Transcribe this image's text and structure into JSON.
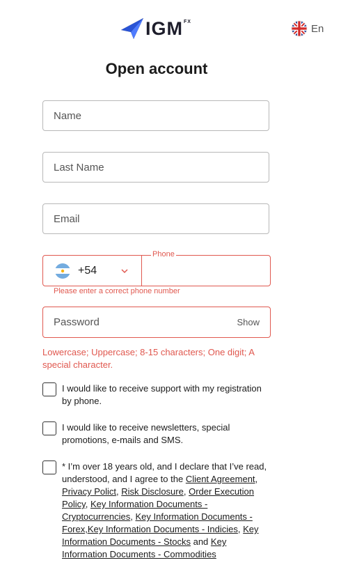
{
  "header": {
    "logo_text": "IGM",
    "logo_superscript": "FX",
    "language_label": "En",
    "language_flag": "uk-flag-icon"
  },
  "title": "Open account",
  "form": {
    "name_placeholder": "Name",
    "last_name_placeholder": "Last Name",
    "email_placeholder": "Email",
    "phone": {
      "legend": "Phone",
      "country_flag": "argentina-flag-icon",
      "dial_code": "+54",
      "error": "Please enter a correct phone number"
    },
    "password_placeholder": "Password",
    "show_label": "Show",
    "password_hint": "Lowercase; Uppercase; 8-15 characters; One digit; A special character."
  },
  "checkboxes": {
    "support_phone": "I would like to receive support with my registration by phone.",
    "newsletters": "I would like to receive newsletters, special promotions, e-mails and SMS.",
    "agreement": {
      "lead": "* I’m over 18 years old, and I declare that I’ve read, understood, and I agree to the ",
      "client_agreement": "Client Agreement",
      "privacy": "Privacy Polict",
      "risk": "Risk Disclosure",
      "order": "Order Execution Policy",
      "kid_crypto": "Key Information Documents - Cryptocurrencies",
      "kid_forex": "Key Information Documents - Forex,",
      "kid_indicies": "Key Information Documents - Indicies",
      "kid_stocks": "Key Information Documents - Stocks",
      "and": "and",
      "kid_commodities": "Key Information Documents - Commodities"
    }
  },
  "colors": {
    "error": "#e0584f",
    "border": "#b8b8b8",
    "logo_blue": "#2a54d6"
  }
}
